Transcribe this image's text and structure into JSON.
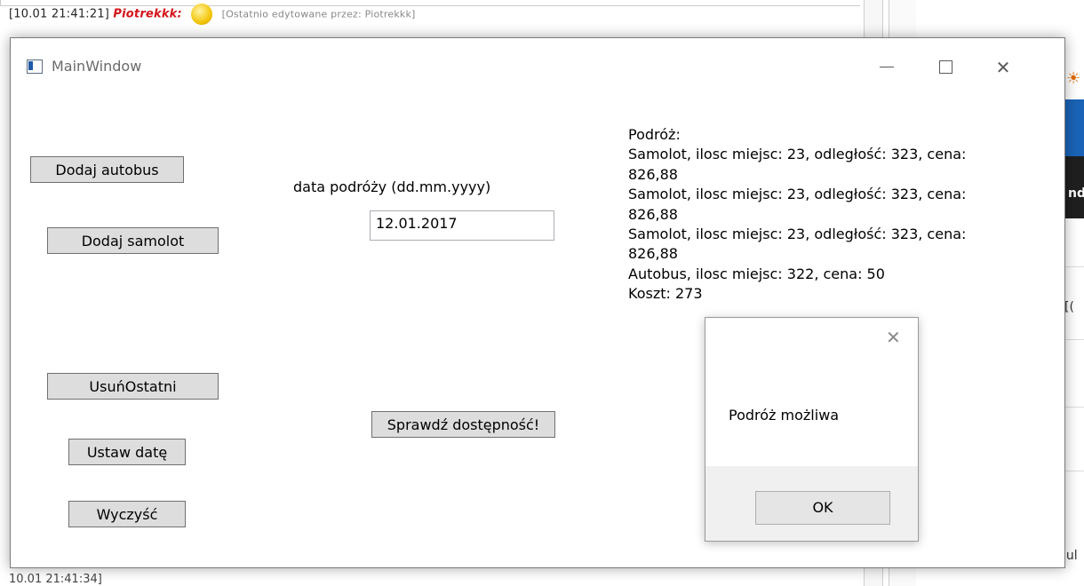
{
  "background": {
    "top_chat": {
      "time": "[10.01 21:41:21]",
      "nick": "Piotrekkk:",
      "meta": "[Ostatnio edytowane przez: Piotrekkk]"
    },
    "right_fragments": {
      "cut_text": "nd",
      "bracket": "[(",
      "lul": "lul"
    },
    "bottom_chat": "10.01 21:41:34]"
  },
  "window": {
    "title": "MainWindow",
    "buttons": {
      "add_bus": "Dodaj autobus",
      "add_plane": "Dodaj samolot",
      "remove_last": "UsuńOstatni",
      "set_date": "Ustaw datę",
      "clear": "Wyczyść",
      "check": "Sprawdź dostępność!"
    },
    "date_label": "data podróży (dd.mm.yyyy)",
    "date_value": "12.01.2017",
    "results": [
      "Podróż:",
      "Samolot, ilosc miejsc: 23, odległość: 323, cena:",
      "826,88",
      "Samolot, ilosc miejsc: 23, odległość: 323, cena:",
      "826,88",
      "Samolot, ilosc miejsc: 23, odległość: 323, cena:",
      "826,88",
      "Autobus, ilosc miejsc: 322, cena: 50",
      "Koszt: 273"
    ]
  },
  "messagebox": {
    "text": "Podróż możliwa",
    "ok_label": "OK"
  }
}
